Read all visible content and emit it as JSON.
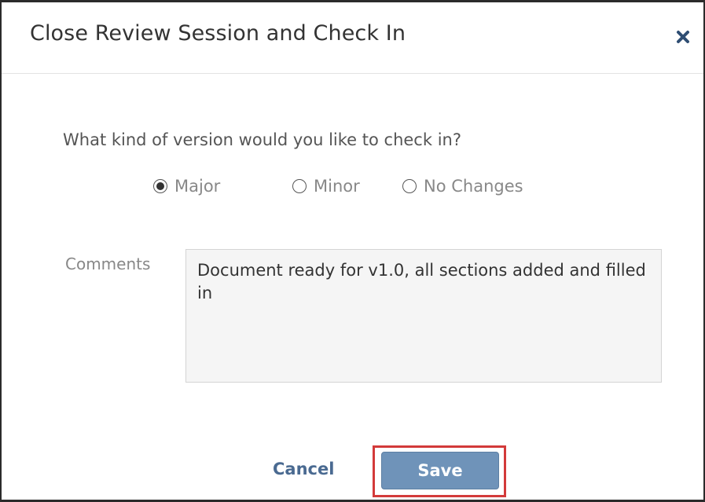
{
  "dialog": {
    "title": "Close Review Session and Check In",
    "close_icon": "close-icon"
  },
  "form": {
    "question": "What kind of version would you like to check in?",
    "version_options": [
      {
        "label": "Major",
        "selected": true
      },
      {
        "label": "Minor",
        "selected": false
      },
      {
        "label": "No Changes",
        "selected": false
      }
    ],
    "comments_label": "Comments",
    "comments_value": "Document ready for v1.0, all sections added and filled in"
  },
  "footer": {
    "cancel_label": "Cancel",
    "save_label": "Save"
  },
  "colors": {
    "save_button": "#6f93b9",
    "link": "#4a6a91",
    "highlight": "#d33a3a"
  }
}
